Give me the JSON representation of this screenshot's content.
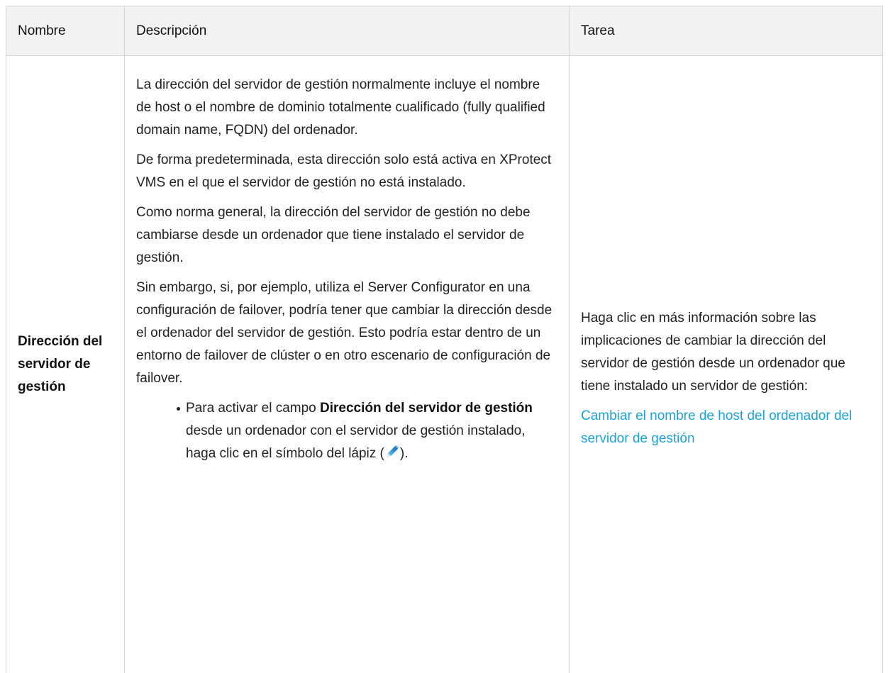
{
  "table": {
    "headers": [
      "Nombre",
      "Descripción",
      "Tarea"
    ],
    "row": {
      "name": "Dirección del servidor de gestión",
      "description": {
        "paragraphs": [
          "La dirección del servidor de gestión normalmente incluye el nombre de host o el nombre de dominio totalmente cualificado (fully qualified domain name, FQDN) del ordenador.",
          "De forma predeterminada, esta dirección solo está activa en XProtect VMS en el que el servidor de gestión no está instalado.",
          "Como norma general, la dirección del servidor de gestión no debe cambiarse desde un ordenador que tiene instalado el servidor de gestión.",
          "Sin embargo, si, por ejemplo, utiliza el Server Configurator en una configuración de failover, podría tener que cambiar la dirección desde el ordenador del servidor de gestión. Esto podría estar dentro de un entorno de failover de clúster o en otro escenario de configuración de failover."
        ],
        "bullet": {
          "prefix": "Para activar el campo ",
          "bold": "Dirección del servidor de gestión",
          "middle": " desde un ordenador con el servidor de gestión instalado, haga clic en el símbolo del lápiz (",
          "icon": "pencil-icon",
          "suffix": ")."
        }
      },
      "task": {
        "text": "Haga clic en más información sobre las implicaciones de cambiar la dirección del servidor de gestión desde un ordenador que tiene instalado un servidor de gestión:",
        "link": "Cambiar el nombre de host del ordenador del servidor de gestión"
      }
    }
  },
  "colors": {
    "link": "#1ca1d8",
    "header_bg": "#f2f2f2",
    "border": "#d4d4d4"
  }
}
